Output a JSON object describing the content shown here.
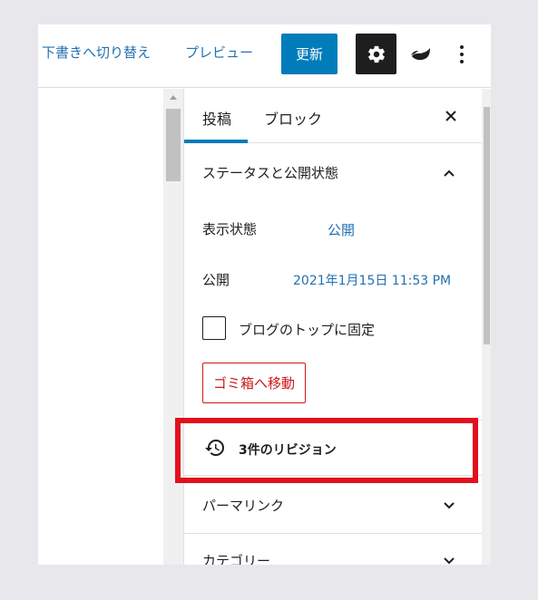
{
  "toolbar": {
    "switch_to_draft": "下書きへ切り替え",
    "preview": "プレビュー",
    "update": "更新",
    "settings_icon": "gear-icon",
    "plugin_icon": "leaf-icon",
    "more_icon": "vertical-ellipsis-icon"
  },
  "sidebar": {
    "tabs": [
      {
        "label": "投稿",
        "active": true
      },
      {
        "label": "ブロック",
        "active": false
      }
    ],
    "close_icon": "close-icon",
    "status_section": {
      "title": "ステータスと公開状態",
      "expanded": true,
      "visibility_label": "表示状態",
      "visibility_value": "公開",
      "publish_label": "公開",
      "publish_value": "2021年1月15日 11:53 PM",
      "sticky_label": "ブログのトップに固定",
      "sticky_checked": false,
      "trash_button": "ゴミ箱へ移動"
    },
    "revisions": {
      "label": "3件のリビジョン",
      "icon": "history-icon"
    },
    "permalink": {
      "title": "パーマリンク",
      "expanded": false
    },
    "category": {
      "title": "カテゴリー",
      "expanded": false
    }
  },
  "colors": {
    "accent": "#007cba",
    "link": "#2271b1",
    "danger": "#cc1818",
    "highlight": "#e2101e",
    "dark": "#1e1e1e"
  }
}
